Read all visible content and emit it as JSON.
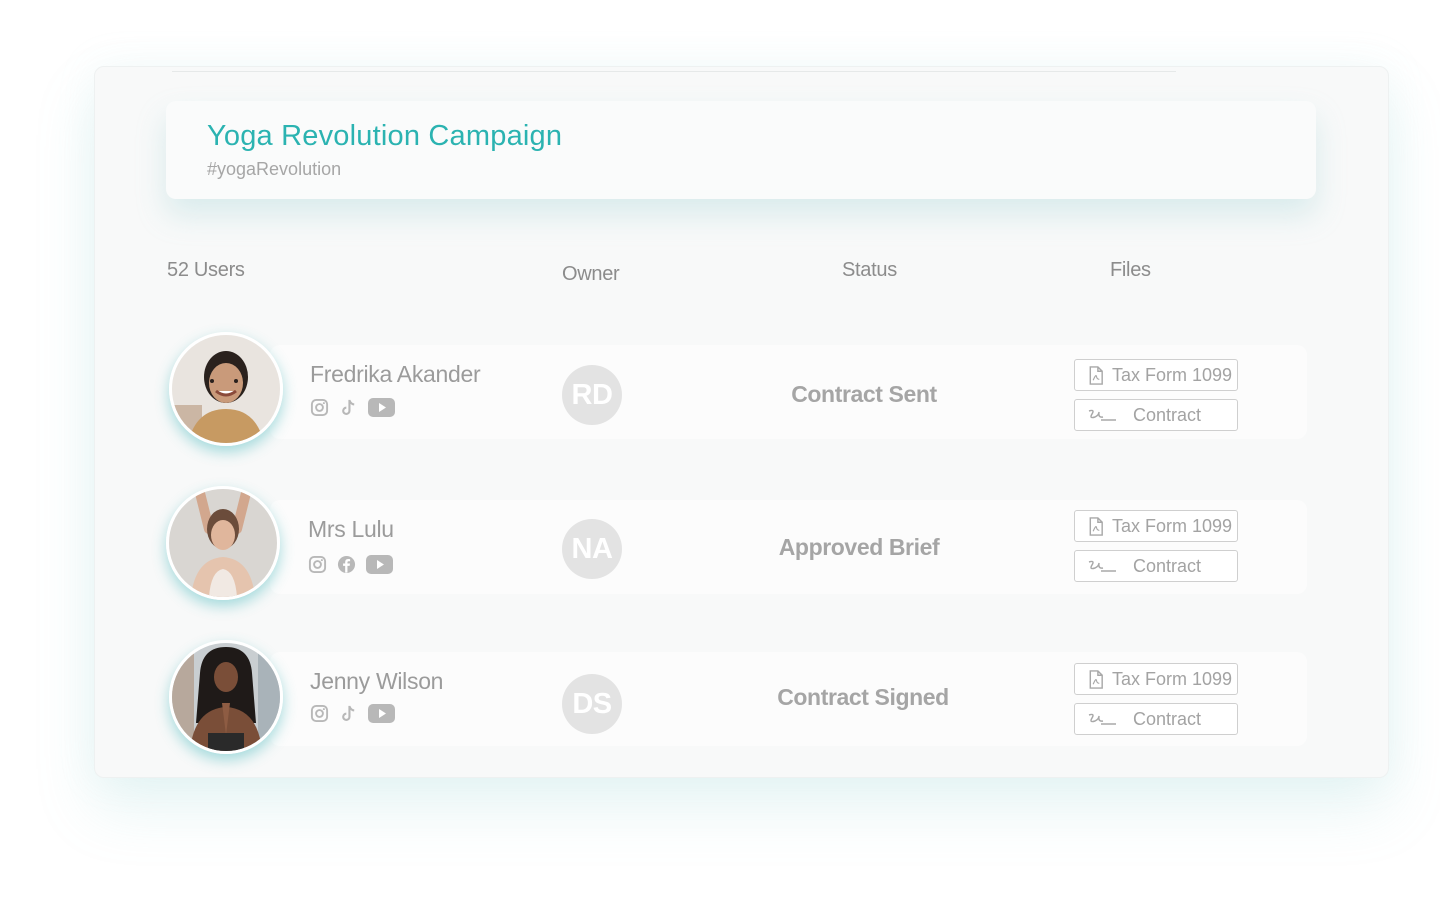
{
  "campaign": {
    "title": "Yoga Revolution Campaign",
    "hashtag": "#yogaRevolution"
  },
  "table": {
    "users_count_label": "52 Users",
    "owner_header": "Owner",
    "status_header": "Status",
    "files_header": "Files"
  },
  "rows": [
    {
      "name": "Fredrika Akander",
      "socials": [
        "instagram-icon",
        "tiktok-icon",
        "youtube-icon"
      ],
      "owner": "RD",
      "status": "Contract Sent",
      "files": [
        "Tax Form 1099",
        "Contract"
      ]
    },
    {
      "name": "Mrs Lulu",
      "socials": [
        "instagram-icon",
        "facebook-icon",
        "youtube-icon"
      ],
      "owner": "NA",
      "status": "Approved Brief",
      "files": [
        "Tax Form 1099",
        "Contract"
      ]
    },
    {
      "name": "Jenny Wilson",
      "socials": [
        "instagram-icon",
        "tiktok-icon",
        "youtube-icon"
      ],
      "owner": "DS",
      "status": "Contract Signed",
      "files": [
        "Tax Form 1099",
        "Contract"
      ]
    }
  ],
  "colors": {
    "accent": "#2bb3b1",
    "muted_text": "#9b9b9b",
    "badge_bg": "#e3e3e3"
  }
}
